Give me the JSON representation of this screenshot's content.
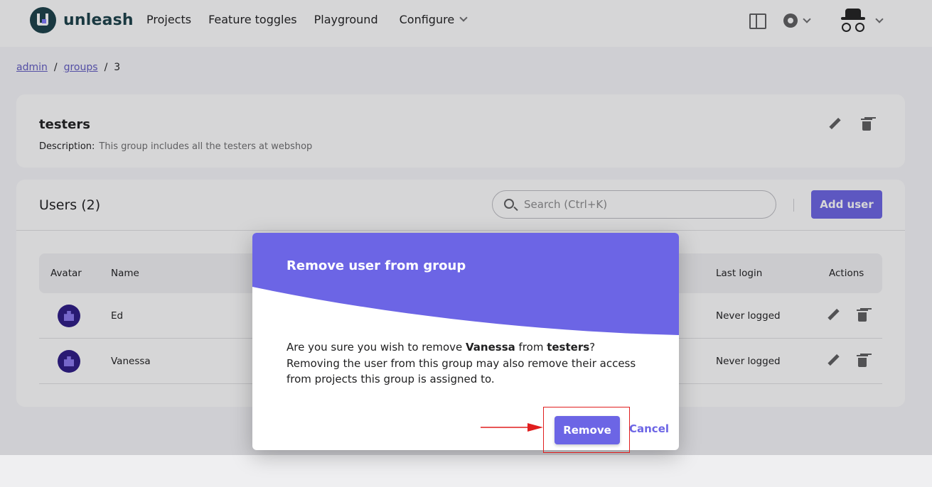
{
  "brand": {
    "name": "unleash"
  },
  "nav": {
    "projects": "Projects",
    "feature_toggles": "Feature toggles",
    "playground": "Playground",
    "configure": "Configure"
  },
  "header_icons": [
    "book-icon",
    "gear-icon",
    "user-avatar-icon"
  ],
  "breadcrumb": {
    "admin": "admin",
    "groups": "groups",
    "current": "3"
  },
  "group": {
    "name": "testers",
    "description_label": "Description:",
    "description": "This group includes all the testers at webshop"
  },
  "users_panel": {
    "title": "Users (2)",
    "search_placeholder": "Search (Ctrl+K)",
    "add_user": "Add user",
    "columns": {
      "avatar": "Avatar",
      "name": "Name",
      "last_login": "Last login",
      "actions": "Actions"
    },
    "rows": [
      {
        "name": "Ed",
        "last_login": "Never logged"
      },
      {
        "name": "Vanessa",
        "last_login": "Never logged"
      }
    ]
  },
  "dialog": {
    "title": "Remove user from group",
    "body_prefix": "Are you sure you wish to remove ",
    "user": "Vanessa",
    "body_mid": " from ",
    "group": "testers",
    "body_suffix": "? Removing the user from this group may also remove their access from projects this group is assigned to.",
    "remove": "Remove",
    "cancel": "Cancel"
  },
  "colors": {
    "primary": "#6c65e5",
    "brand_dark": "#1a4049",
    "highlight": "#e01e1e"
  }
}
